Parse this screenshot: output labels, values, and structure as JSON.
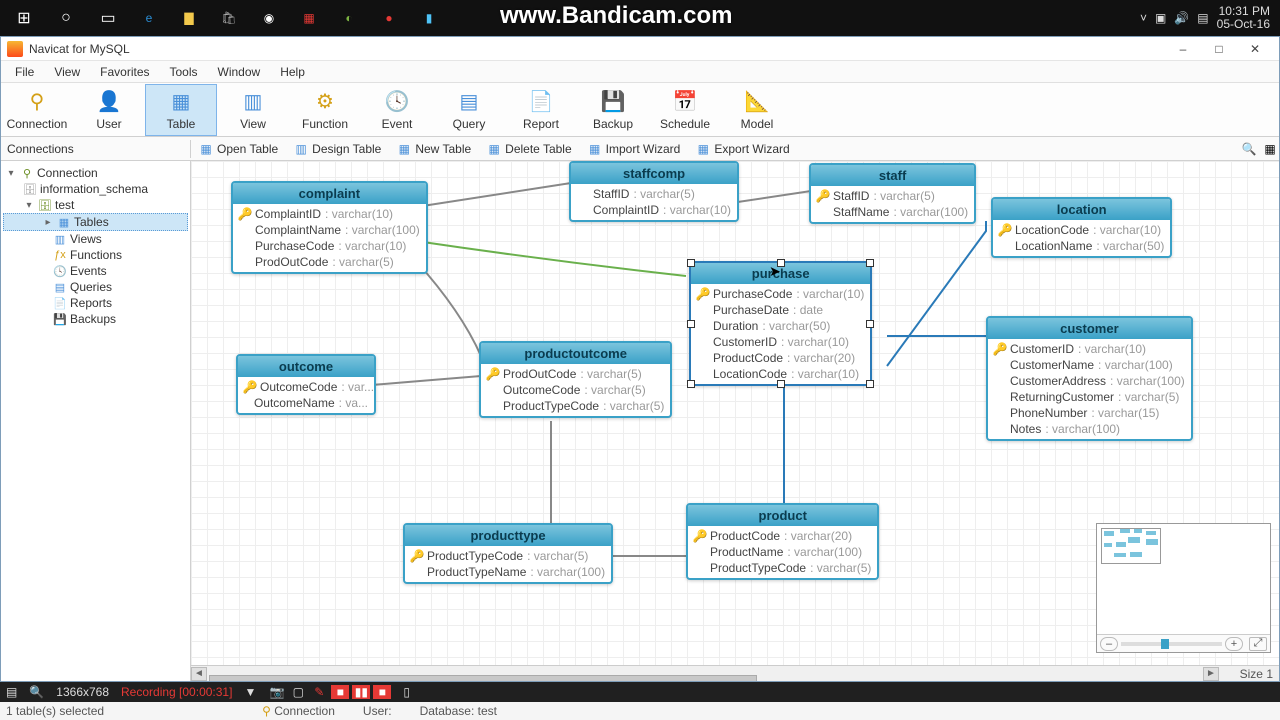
{
  "taskbar": {
    "watermark": "www.Bandicam.com",
    "time": "10:31 PM",
    "date": "05-Oct-16"
  },
  "window": {
    "title": "Navicat for MySQL",
    "controls": {
      "min": "–",
      "max": "□",
      "close": "✕"
    }
  },
  "menu": [
    "File",
    "View",
    "Favorites",
    "Tools",
    "Window",
    "Help"
  ],
  "toolbar": [
    {
      "label": "Connection"
    },
    {
      "label": "User"
    },
    {
      "label": "Table"
    },
    {
      "label": "View"
    },
    {
      "label": "Function"
    },
    {
      "label": "Event"
    },
    {
      "label": "Query"
    },
    {
      "label": "Report"
    },
    {
      "label": "Backup"
    },
    {
      "label": "Schedule"
    },
    {
      "label": "Model"
    }
  ],
  "connections_label": "Connections",
  "subtoolbar": [
    {
      "label": "Open Table"
    },
    {
      "label": "Design Table"
    },
    {
      "label": "New Table"
    },
    {
      "label": "Delete Table"
    },
    {
      "label": "Import Wizard"
    },
    {
      "label": "Export Wizard"
    }
  ],
  "tree": {
    "root": "Connection",
    "db1": "information_schema",
    "db2": "test",
    "items": [
      "Tables",
      "Views",
      "Functions",
      "Events",
      "Queries",
      "Reports",
      "Backups"
    ]
  },
  "entities": {
    "complaint": {
      "title": "complaint",
      "fields": [
        {
          "k": true,
          "name": "ComplaintID",
          "type": ": varchar(10)"
        },
        {
          "k": false,
          "name": "ComplaintName",
          "type": ": varchar(100)"
        },
        {
          "k": false,
          "name": "PurchaseCode",
          "type": ": varchar(10)"
        },
        {
          "k": false,
          "name": "ProdOutCode",
          "type": ": varchar(5)"
        }
      ]
    },
    "staffcomp": {
      "title": "staffcomp",
      "fields": [
        {
          "k": false,
          "name": "StaffID",
          "type": ": varchar(5)"
        },
        {
          "k": false,
          "name": "ComplaintID",
          "type": ": varchar(10)"
        }
      ]
    },
    "staff": {
      "title": "staff",
      "fields": [
        {
          "k": true,
          "name": "StaffID",
          "type": ": varchar(5)"
        },
        {
          "k": false,
          "name": "StaffName",
          "type": ": varchar(100)"
        }
      ]
    },
    "location": {
      "title": "location",
      "fields": [
        {
          "k": true,
          "name": "LocationCode",
          "type": ": varchar(10)"
        },
        {
          "k": false,
          "name": "LocationName",
          "type": ": varchar(50)"
        }
      ]
    },
    "purchase": {
      "title": "purchase",
      "fields": [
        {
          "k": true,
          "name": "PurchaseCode",
          "type": ": varchar(10)"
        },
        {
          "k": false,
          "name": "PurchaseDate",
          "type": ": date"
        },
        {
          "k": false,
          "name": "Duration",
          "type": ": varchar(50)"
        },
        {
          "k": false,
          "name": "CustomerID",
          "type": ": varchar(10)"
        },
        {
          "k": false,
          "name": "ProductCode",
          "type": ": varchar(20)"
        },
        {
          "k": false,
          "name": "LocationCode",
          "type": ": varchar(10)"
        }
      ]
    },
    "outcome": {
      "title": "outcome",
      "fields": [
        {
          "k": true,
          "name": "OutcomeCode",
          "type": ": var..."
        },
        {
          "k": false,
          "name": "OutcomeName",
          "type": ": va..."
        }
      ]
    },
    "productoutcome": {
      "title": "productoutcome",
      "fields": [
        {
          "k": true,
          "name": "ProdOutCode",
          "type": ": varchar(5)"
        },
        {
          "k": false,
          "name": "OutcomeCode",
          "type": ": varchar(5)"
        },
        {
          "k": false,
          "name": "ProductTypeCode",
          "type": ": varchar(5)"
        }
      ]
    },
    "customer": {
      "title": "customer",
      "fields": [
        {
          "k": true,
          "name": "CustomerID",
          "type": ": varchar(10)"
        },
        {
          "k": false,
          "name": "CustomerName",
          "type": ": varchar(100)"
        },
        {
          "k": false,
          "name": "CustomerAddress",
          "type": ": varchar(100)"
        },
        {
          "k": false,
          "name": "ReturningCustomer",
          "type": ": varchar(5)"
        },
        {
          "k": false,
          "name": "PhoneNumber",
          "type": ": varchar(15)"
        },
        {
          "k": false,
          "name": "Notes",
          "type": ": varchar(100)"
        }
      ]
    },
    "producttype": {
      "title": "producttype",
      "fields": [
        {
          "k": true,
          "name": "ProductTypeCode",
          "type": ": varchar(5)"
        },
        {
          "k": false,
          "name": "ProductTypeName",
          "type": ": varchar(100)"
        }
      ]
    },
    "product": {
      "title": "product",
      "fields": [
        {
          "k": true,
          "name": "ProductCode",
          "type": ": varchar(20)"
        },
        {
          "k": false,
          "name": "ProductName",
          "type": ": varchar(100)"
        },
        {
          "k": false,
          "name": "ProductTypeCode",
          "type": ": varchar(5)"
        }
      ]
    }
  },
  "recbar": {
    "res": "1366x768",
    "status": "Recording [00:00:31]"
  },
  "statusbar": {
    "selection": "1 table(s) selected",
    "conn": "Connection",
    "user": "User:",
    "db": "Database: test"
  },
  "size_label": "Size 1"
}
